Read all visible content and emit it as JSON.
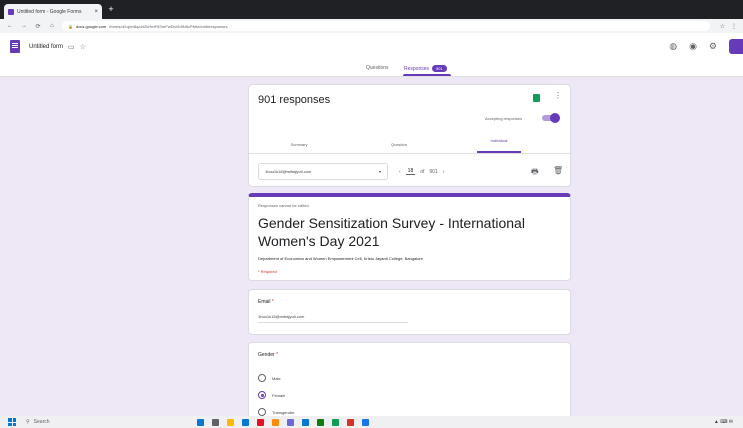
{
  "browser": {
    "tab_title": "Untitled form - Google Forms",
    "tab_close": "×",
    "new_tab": "+",
    "url_host": "docs.google.com",
    "url_path": "/forms/d/1qlmBqaI4ZkHmF5SmFwDbVb9N8vPMsr/edit#responses",
    "nav_back": "←",
    "nav_forward": "→",
    "nav_reload": "⟳",
    "nav_home": "⌂",
    "lock": "🔒",
    "star": "☆",
    "ext_menu": "⋮"
  },
  "forms_header": {
    "title": "Untitled form",
    "folder_icon": "▭",
    "star_icon": "☆",
    "palette_icon": "◍",
    "preview_icon": "◉",
    "settings_icon": "⚙"
  },
  "subnav": {
    "questions": "Questions",
    "responses": "Responses",
    "response_badge": "901"
  },
  "summary_card": {
    "count_text": "901 responses",
    "accepting_label": "Accepting responses",
    "tabs": [
      "Summary",
      "Question",
      "Individual"
    ],
    "selected_email": "1hou1k18@mitrajyoti.com",
    "select_caret": "▾",
    "pager_prev": "‹",
    "pager_current": "18",
    "pager_of": "of",
    "pager_total": "901",
    "pager_next": "›",
    "print_icon": "🖶",
    "trash_icon": "🗑",
    "more_icon": "⋮",
    "accent": "#673ab7",
    "sheets_green": "#0f9d58"
  },
  "header_card": {
    "no_edit_note": "Responses cannot be edited",
    "title": "Gender Sensitization Survey - International Women's Day 2021",
    "description": "Department of Economics and Women Empowerment Cell, Kristu Jayanti College, Bangalore",
    "required_note": "* Required"
  },
  "email_question": {
    "label": "Email",
    "required_star": "*",
    "answer": "1hou1k18@mitrajyoti.com"
  },
  "gender_question": {
    "label": "Gender",
    "required_star": "*",
    "options": [
      "Male",
      "Female",
      "Transgender"
    ],
    "selected": "Female"
  },
  "taskbar": {
    "search_placeholder": "Search",
    "search_icon": "⚲",
    "tray": "▲ ⌨ ✉",
    "icon_colors": [
      "#0078d4",
      "#5f6368",
      "#ffb900",
      "#0078d4",
      "#e81123",
      "#ff8c00",
      "#6b69d6",
      "#0078d4",
      "#107c10",
      "#0f9d58",
      "#d93025",
      "#1a73e8"
    ]
  }
}
